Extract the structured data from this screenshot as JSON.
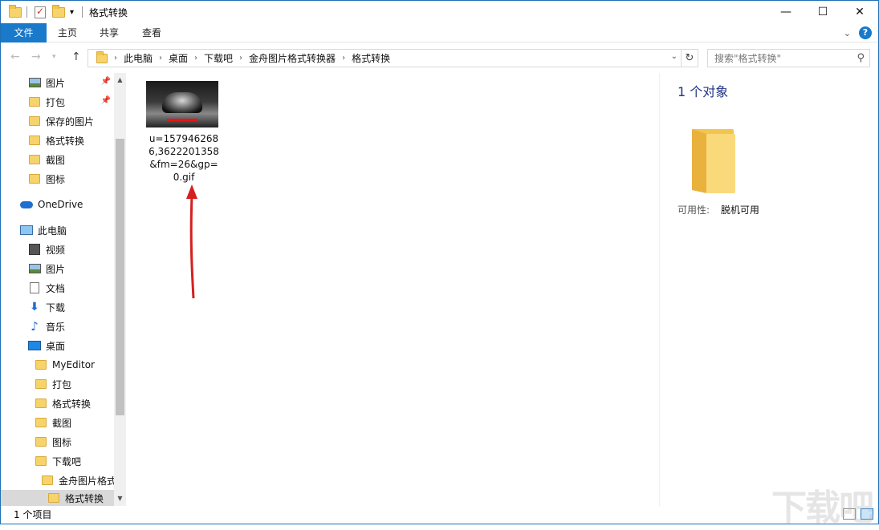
{
  "window": {
    "title": "格式转换"
  },
  "ribbon": {
    "tabs": [
      "文件",
      "主页",
      "共享",
      "查看"
    ]
  },
  "address": {
    "crumbs": [
      "此电脑",
      "桌面",
      "下载吧",
      "金舟图片格式转换器",
      "格式转换"
    ]
  },
  "search": {
    "placeholder": "搜索\"格式转换\""
  },
  "sidebar": {
    "quick": [
      {
        "label": "图片",
        "icon": "picture-icon",
        "pinned": true
      },
      {
        "label": "打包",
        "icon": "folder-icon",
        "pinned": true
      },
      {
        "label": "保存的图片",
        "icon": "folder-icon"
      },
      {
        "label": "格式转换",
        "icon": "folder-icon"
      },
      {
        "label": "截图",
        "icon": "folder-icon"
      },
      {
        "label": "图标",
        "icon": "folder-icon"
      }
    ],
    "onedrive": "OneDrive",
    "thispc": "此电脑",
    "pc_items": [
      {
        "label": "视频",
        "icon": "video-icon"
      },
      {
        "label": "图片",
        "icon": "picture-icon"
      },
      {
        "label": "文档",
        "icon": "document-icon"
      },
      {
        "label": "下载",
        "icon": "download-icon"
      },
      {
        "label": "音乐",
        "icon": "music-icon"
      },
      {
        "label": "桌面",
        "icon": "desktop-icon"
      }
    ],
    "desktop_items": [
      "MyEditor",
      "打包",
      "格式转换",
      "截图",
      "图标",
      "下载吧"
    ],
    "sub1": "金舟图片格式",
    "sub2": "格式转换"
  },
  "file": {
    "name": "u=1579462686,3622201358&fm=26&gp=0.gif"
  },
  "details": {
    "title": "1 个对象",
    "availability_label": "可用性:",
    "availability_value": "脱机可用"
  },
  "status": {
    "count": "1 个项目"
  },
  "watermark": "下载吧"
}
